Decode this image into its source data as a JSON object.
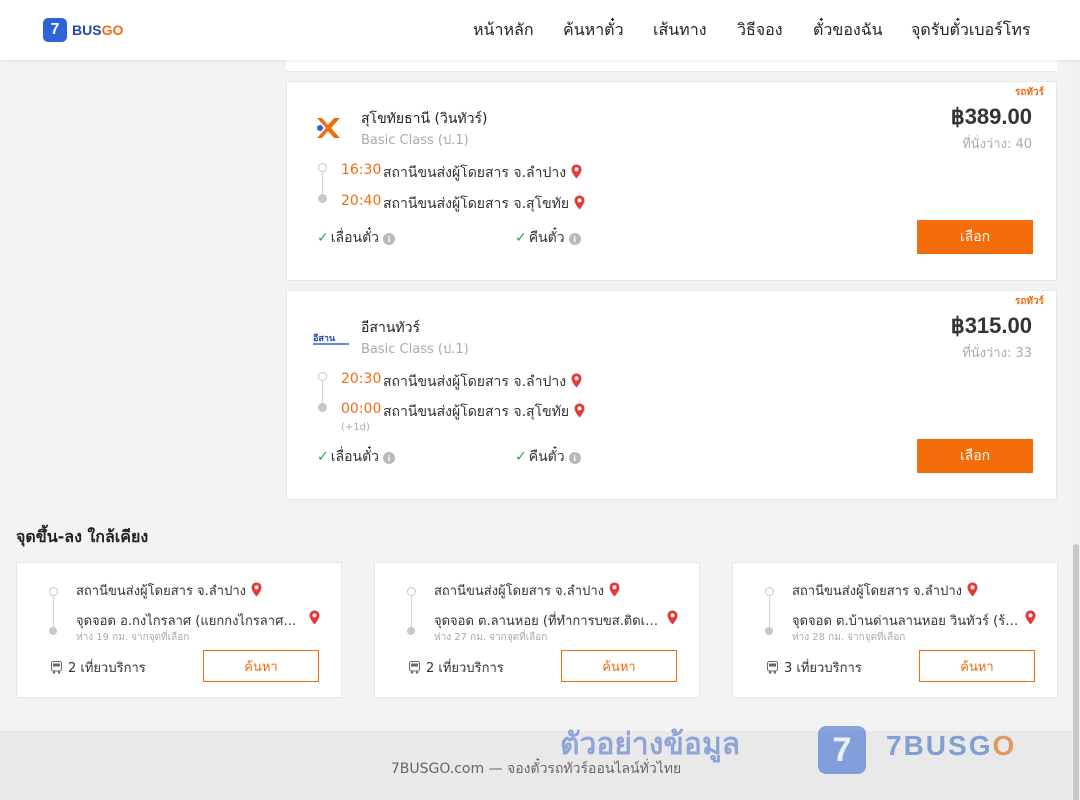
{
  "brand": {
    "digit": "7",
    "part1": "BUS",
    "part2": "GO"
  },
  "nav": [
    "หน้าหลัก",
    "ค้นหาตั๋ว",
    "เส้นทาง",
    "วิธีจอง",
    "ตั๋วของฉัน",
    "จุดรับตั๋วเบอร์โทร"
  ],
  "trips": [
    {
      "tag": "รถทัวร์",
      "operator": "สุโขทัยธานี (วินทัวร์)",
      "class": "Basic Class (ป.1)",
      "price": "฿389.00",
      "seats": "ที่นั่งว่าง: 40",
      "depart_time": "16:30",
      "depart_station": "สถานีขนส่งผู้โดยสาร จ.ลำปาง",
      "arrive_time": "20:40",
      "arrive_station": "สถานีขนส่งผู้โดยสาร จ.สุโขทัย",
      "plus_day": "",
      "feature1": "เลื่อนตั๋ว",
      "feature2": "คืนตั๋ว",
      "button": "เลือก"
    },
    {
      "tag": "รถทัวร์",
      "operator": "อีสานทัวร์",
      "class": "Basic Class (ป.1)",
      "price": "฿315.00",
      "seats": "ที่นั่งว่าง: 33",
      "depart_time": "20:30",
      "depart_station": "สถานีขนส่งผู้โดยสาร จ.ลำปาง",
      "arrive_time": "00:00",
      "arrive_station": "สถานีขนส่งผู้โดยสาร จ.สุโขทัย",
      "plus_day": "(+1d)",
      "feature1": "เลื่อนตั๋ว",
      "feature2": "คืนตั๋ว",
      "button": "เลือก"
    }
  ],
  "nearby": {
    "title": "จุดขึ้น-ลง ใกล้เคียง",
    "items": [
      {
        "from": "สถานีขนส่งผู้โดยสาร จ.ลำปาง",
        "to": "จุดจอด อ.กงไกรลาศ (แยกกงไกรลาศติดต่อ)",
        "distance": "ห่าง 19 กม. จากจุดที่เลือก",
        "trips": "2 เที่ยวบริการ",
        "button": "ค้นหา"
      },
      {
        "from": "สถานีขนส่งผู้โดยสาร จ.ลำปาง",
        "to": "จุดจอด ต.ลานหอย (ที่ทำการบขส.ติดเคาน์เตอร์)",
        "distance": "ห่าง 27 กม. จากจุดที่เลือก",
        "trips": "2 เที่ยวบริการ",
        "button": "ค้นหา"
      },
      {
        "from": "สถานีขนส่งผู้โดยสาร จ.ลำปาง",
        "to": "จุดจอด ต.บ้านด่านลานหอย วินทัวร์ (ร้านค้า)",
        "distance": "ห่าง 28 กม. จากจุดที่เลือก",
        "trips": "3 เที่ยวบริการ",
        "button": "ค้นหา"
      }
    ]
  },
  "footer": "7BUSGO.com — จองตั๋วรถทัวร์ออนไลน์ทั่วไทย",
  "watermark": {
    "text": "ตัวอย่างข้อมูล",
    "brand_a": "7BUSG",
    "brand_b": "O"
  },
  "colors": {
    "accent": "#f56c0a",
    "brand_blue": "#2d63d8",
    "success": "#31a24c",
    "pin": "#e53935"
  }
}
